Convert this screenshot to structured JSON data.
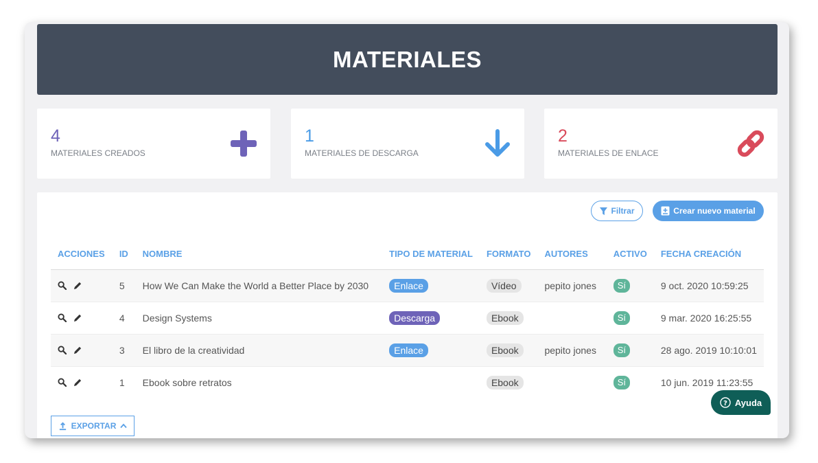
{
  "header": {
    "title": "MATERIALES"
  },
  "stats": [
    {
      "value": "4",
      "label": "MATERIALES CREADOS",
      "color": "#6e63b8",
      "icon": "plus-icon"
    },
    {
      "value": "1",
      "label": "MATERIALES DE DESCARGA",
      "color": "#4a9be6",
      "icon": "arrow-down-icon"
    },
    {
      "value": "2",
      "label": "MATERIALES DE ENLACE",
      "color": "#d94b5b",
      "icon": "link-icon"
    }
  ],
  "toolbar": {
    "filter_label": "Filtrar",
    "new_label": "Crear nuevo material"
  },
  "table": {
    "columns": [
      "ACCIONES",
      "ID",
      "NOMBRE",
      "TIPO DE MATERIAL",
      "FORMATO",
      "AUTORES",
      "ACTIVO",
      "FECHA CREACIÓN"
    ],
    "rows": [
      {
        "id": "5",
        "name": "How We Can Make the World a Better Place by 2030",
        "type": "Enlace",
        "type_color": "#5aa0e6",
        "format": "Vídeo",
        "authors": "pepito jones",
        "active": "Sí",
        "date": "9 oct. 2020 10:59:25"
      },
      {
        "id": "4",
        "name": "Design Systems",
        "type": "Descarga",
        "type_color": "#6e63b8",
        "format": "Ebook",
        "authors": "",
        "active": "Sí",
        "date": "9 mar. 2020 16:25:55"
      },
      {
        "id": "3",
        "name": "El libro de la creatividad",
        "type": "Enlace",
        "type_color": "#5aa0e6",
        "format": "Ebook",
        "authors": "pepito jones",
        "active": "Sí",
        "date": "28 ago. 2019 10:10:01"
      },
      {
        "id": "1",
        "name": "Ebook sobre retratos",
        "type": "",
        "type_color": "",
        "format": "Ebook",
        "authors": "",
        "active": "Sí",
        "date": "10 jun. 2019 11:23:55"
      }
    ]
  },
  "export": {
    "label": "EXPORTAR"
  },
  "help": {
    "label": "Ayuda"
  }
}
